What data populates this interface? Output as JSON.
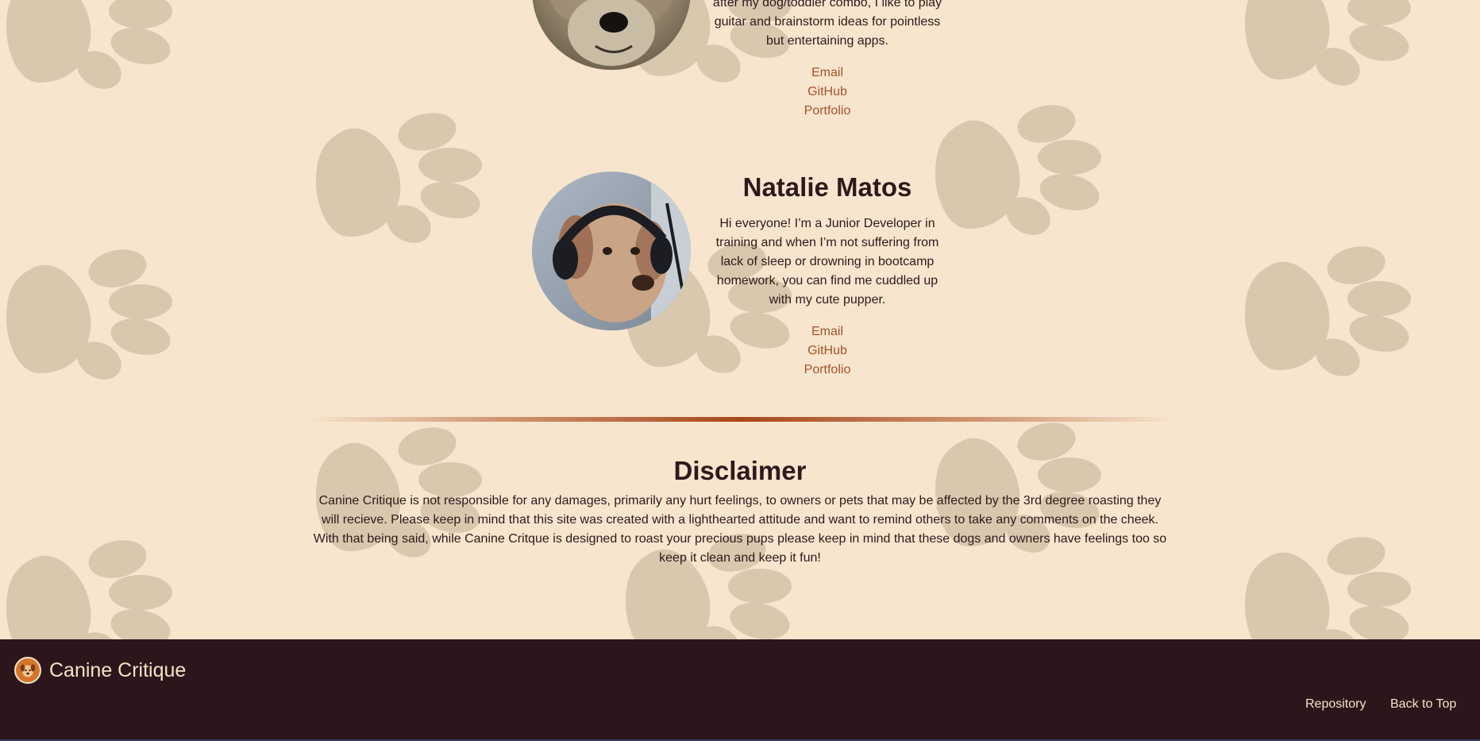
{
  "members": [
    {
      "name": "",
      "bio": "dog enthusiast! When I'm not cleaning up after my dog/toddler combo, I like to play guitar and brainstorm ideas for pointless but entertaining apps.",
      "links": {
        "email": "Email",
        "github": "GitHub",
        "portfolio": "Portfolio"
      }
    },
    {
      "name": "Natalie Matos",
      "bio": "Hi everyone! I’m a Junior Developer in training and when I’m not suffering from lack of sleep or drowning in bootcamp homework, you can find me cuddled up with my cute pupper.",
      "links": {
        "email": "Email",
        "github": "GitHub",
        "portfolio": "Portfolio"
      }
    }
  ],
  "disclaimer": {
    "title": "Disclaimer",
    "text": "Canine Critique is not responsible for any damages, primarily any hurt feelings, to owners or pets that may be affected by the 3rd degree roasting they will recieve. Please keep in mind that this site was created with a lighthearted attitude and want to remind others to take any comments on the cheek. With that being said, while Canine Critque is designed to roast your precious pups please keep in mind that these dogs and owners have feelings too so keep it clean and keep it fun!"
  },
  "footer": {
    "brand": "Canine Critique",
    "repository": "Repository",
    "back_to_top": "Back to Top"
  },
  "icons": {
    "background": "paw-print-icon",
    "logo": "dog-face-icon"
  },
  "colors": {
    "page_background": "#f7e5cd",
    "paw": "#d8c8ae",
    "link": "#a4532b",
    "footer_background": "#2c161b",
    "footer_text": "#f5e2c6",
    "divider": "#a8461a"
  }
}
